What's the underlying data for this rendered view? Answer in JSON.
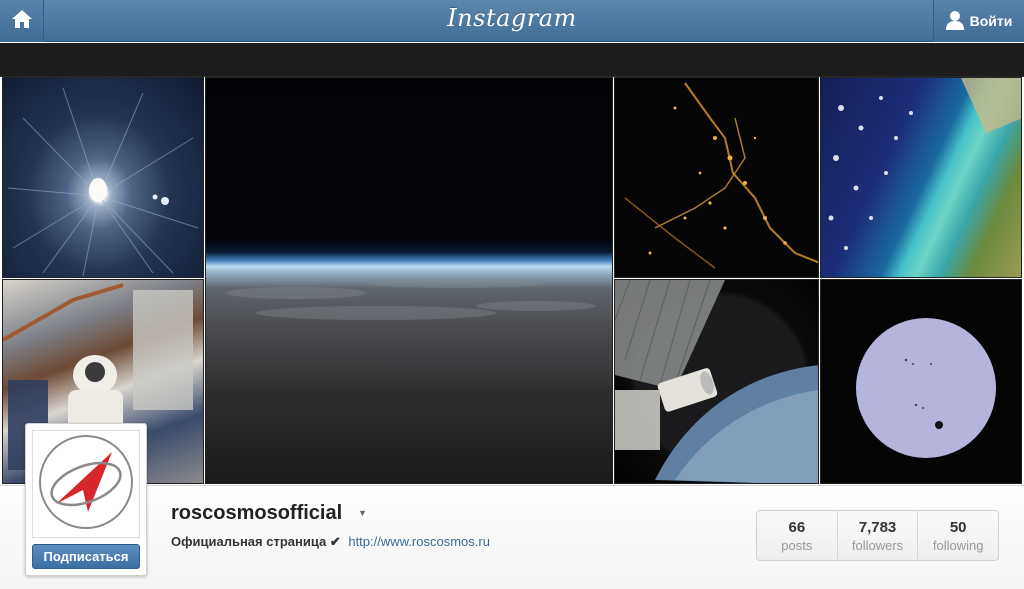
{
  "header": {
    "home_icon": "house-icon",
    "logo_text": "Instagram",
    "login_icon": "person-icon",
    "login_label": "Войти"
  },
  "photos": [
    {
      "subject": "volcano-from-orbit"
    },
    {
      "subject": "earth-horizon-at-dawn"
    },
    {
      "subject": "city-lights-at-night"
    },
    {
      "subject": "coastline-turquoise-shoals"
    },
    {
      "subject": "cosmonaut-spacewalk"
    },
    {
      "subject": "station-module-through-window"
    },
    {
      "subject": "venus-transit-sun"
    }
  ],
  "profile": {
    "avatar_icon": "roscosmos-logo",
    "follow_label": "Подписаться",
    "username": "roscosmosofficial",
    "bio_text": "Официальная страница ✔",
    "bio_link": "http://www.roscosmos.ru"
  },
  "stats": [
    {
      "value": "66",
      "label": "posts"
    },
    {
      "value": "7,783",
      "label": "followers"
    },
    {
      "value": "50",
      "label": "following"
    }
  ],
  "colors": {
    "header": "#4a77a1",
    "button": "#4a7db1",
    "logo_red": "#d7262b"
  }
}
